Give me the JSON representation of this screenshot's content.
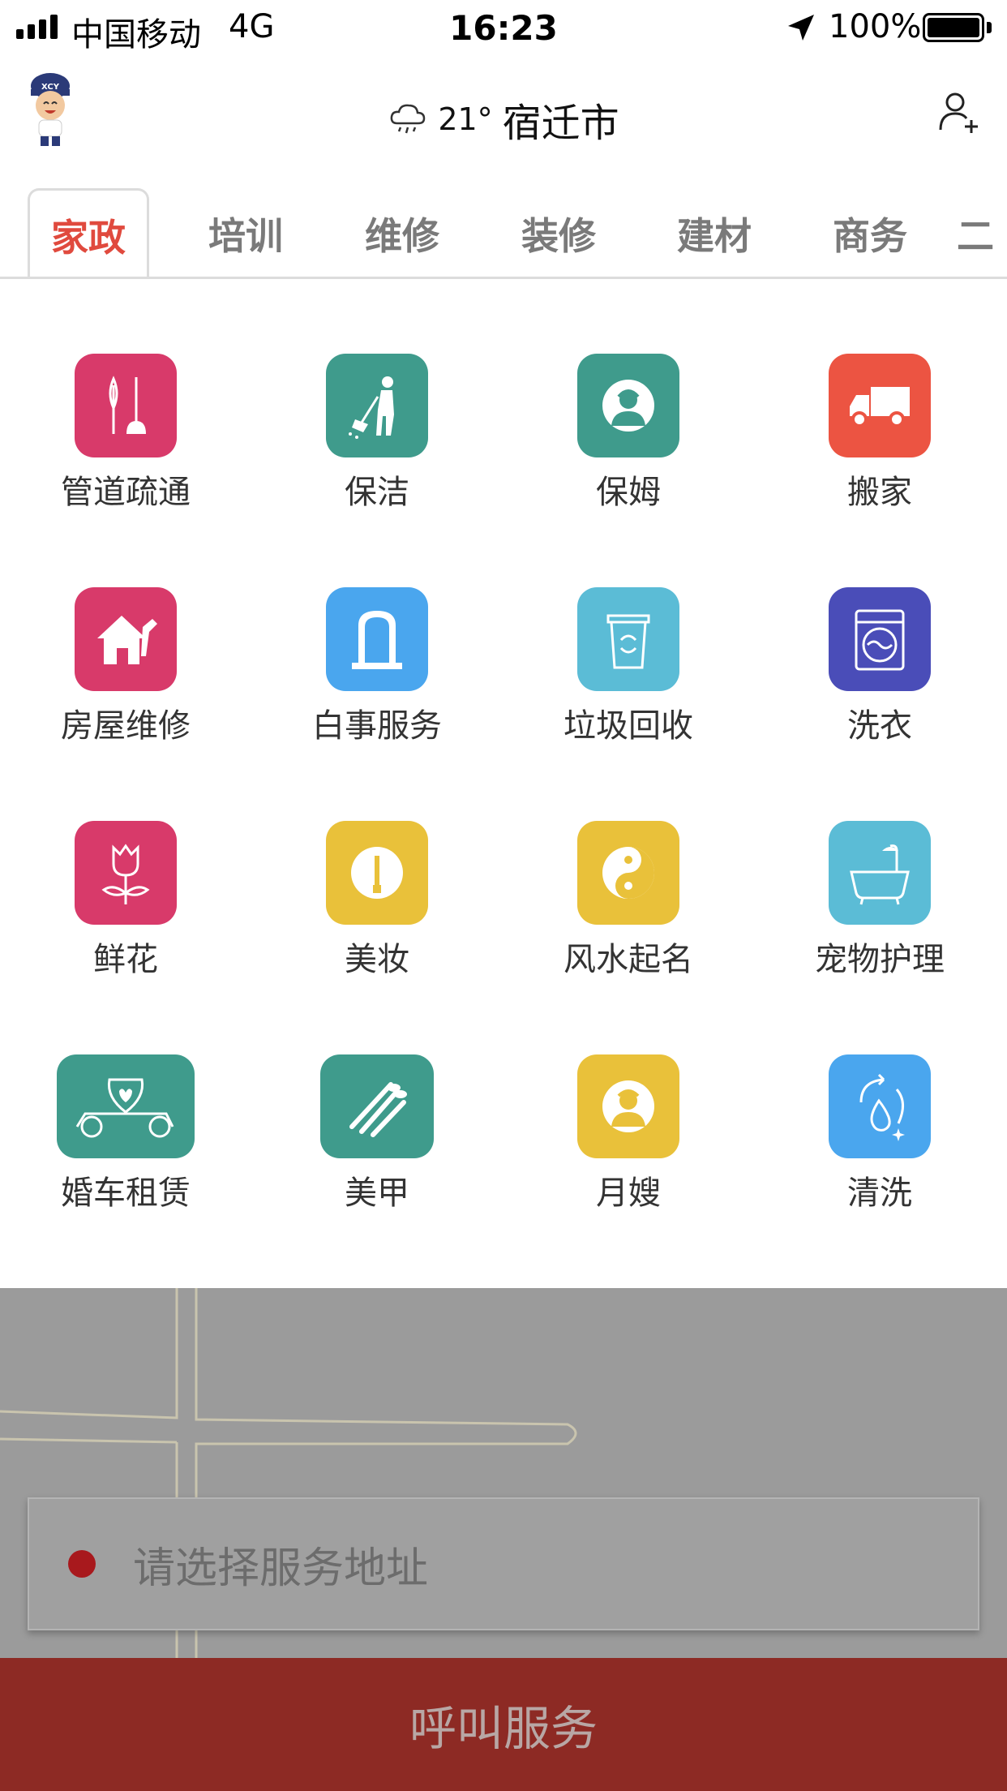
{
  "status_bar": {
    "carrier": "中国移动",
    "network": "4G",
    "time": "16:23",
    "battery": "100%"
  },
  "header": {
    "temperature": "21°",
    "city": "宿迁市",
    "avatar_text": "XCY"
  },
  "tabs": [
    {
      "label": "家政",
      "active": true
    },
    {
      "label": "培训",
      "active": false
    },
    {
      "label": "维修",
      "active": false
    },
    {
      "label": "装修",
      "active": false
    },
    {
      "label": "建材",
      "active": false
    },
    {
      "label": "商务",
      "active": false
    },
    {
      "label": "二",
      "active": false
    }
  ],
  "services": [
    {
      "label": "管道疏通",
      "icon": "pipe-dredge-icon",
      "color": "#d83a6a"
    },
    {
      "label": "保洁",
      "icon": "cleaning-icon",
      "color": "#3f9b8c"
    },
    {
      "label": "保姆",
      "icon": "nanny-icon",
      "color": "#3f9b8c"
    },
    {
      "label": "搬家",
      "icon": "moving-truck-icon",
      "color": "#ec5442"
    },
    {
      "label": "房屋维修",
      "icon": "house-repair-icon",
      "color": "#d83a6a"
    },
    {
      "label": "白事服务",
      "icon": "funeral-icon",
      "color": "#4aa6ee"
    },
    {
      "label": "垃圾回收",
      "icon": "recycle-bin-icon",
      "color": "#5bbcd6"
    },
    {
      "label": "洗衣",
      "icon": "washing-machine-icon",
      "color": "#4a4db8"
    },
    {
      "label": "鲜花",
      "icon": "rose-icon",
      "color": "#d83a6a"
    },
    {
      "label": "美妆",
      "icon": "makeup-icon",
      "color": "#e9c13a"
    },
    {
      "label": "风水起名",
      "icon": "yin-yang-icon",
      "color": "#e9c13a"
    },
    {
      "label": "宠物护理",
      "icon": "pet-bath-icon",
      "color": "#5bbcd6"
    },
    {
      "label": "婚车租赁",
      "icon": "wedding-car-icon",
      "color": "#3f9b8c"
    },
    {
      "label": "美甲",
      "icon": "manicure-icon",
      "color": "#3f9b8c"
    },
    {
      "label": "月嫂",
      "icon": "maternity-nurse-icon",
      "color": "#e9c13a"
    },
    {
      "label": "清洗",
      "icon": "wash-drop-icon",
      "color": "#4aa6ee"
    }
  ],
  "address": {
    "placeholder": "请选择服务地址"
  },
  "call_button": {
    "label": "呼叫服务"
  },
  "colors": {
    "accent": "#e04a3e",
    "call_button": "#8d2a24",
    "pin": "#a8191d"
  }
}
